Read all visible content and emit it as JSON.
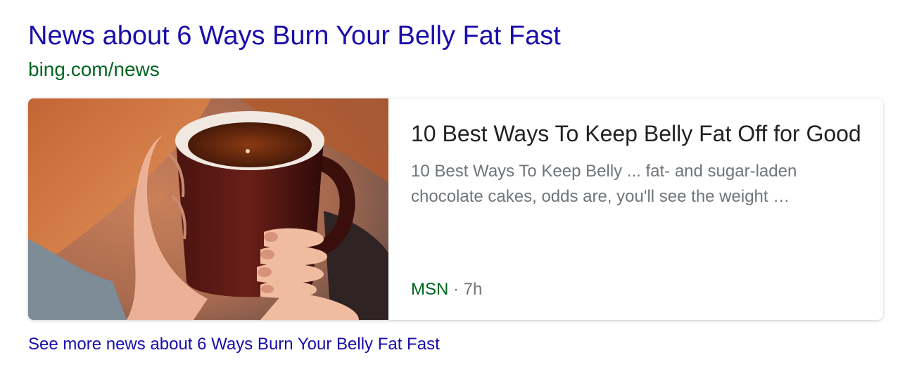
{
  "result": {
    "title": "News about 6 Ways Burn Your Belly Fat Fast",
    "url": "bing.com/news"
  },
  "news_card": {
    "image_subject": "hands-holding-mug-icon",
    "headline": "10 Best Ways To Keep Belly Fat Off for Good",
    "snippet": "10 Best Ways To Keep Belly ... fat- and sugar-laden chocolate cakes, odds are, you'll see the weight …",
    "source": "MSN",
    "separator": " · ",
    "age": "7h"
  },
  "see_more": {
    "label": "See more news about 6 Ways Burn Your Belly Fat Fast"
  },
  "colors": {
    "link": "#1a0dab",
    "url_green": "#006621",
    "headline": "#222222",
    "muted": "#70757a"
  }
}
